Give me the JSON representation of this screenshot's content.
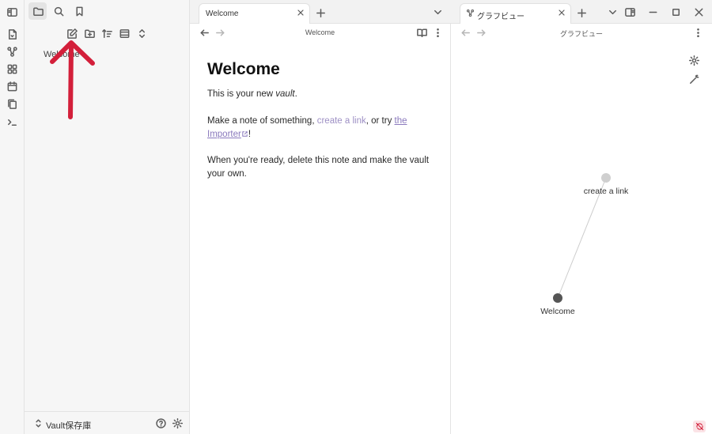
{
  "sidebar": {
    "file_item": "Welcome",
    "vault_name": "Vault保存庫"
  },
  "left_pane": {
    "tab_label": "Welcome",
    "view_title": "Welcome",
    "note": {
      "title": "Welcome",
      "p1_before": "This is your new ",
      "p1_em": "vault",
      "p1_after": ".",
      "p2_before": "Make a note of something, ",
      "p2_link1": "create a link",
      "p2_middle": ", or try ",
      "p2_link2a": "the ",
      "p2_link2b": "Importer",
      "p2_after": "!",
      "p3": "When you're ready, delete this note and make the vault your own."
    }
  },
  "right_pane": {
    "tab_label": "グラフビュー",
    "view_title": "グラフビュー",
    "graph": {
      "nodes": [
        {
          "id": "create-a-link",
          "label": "create a link",
          "color": "#cfcfcf"
        },
        {
          "id": "welcome",
          "label": "Welcome",
          "color": "#555555"
        }
      ],
      "edge_color": "#cccccc"
    }
  },
  "colors": {
    "annotation_arrow": "#d31f3a",
    "internal_link": "#9d8fc4",
    "external_link": "#8a79bd"
  }
}
